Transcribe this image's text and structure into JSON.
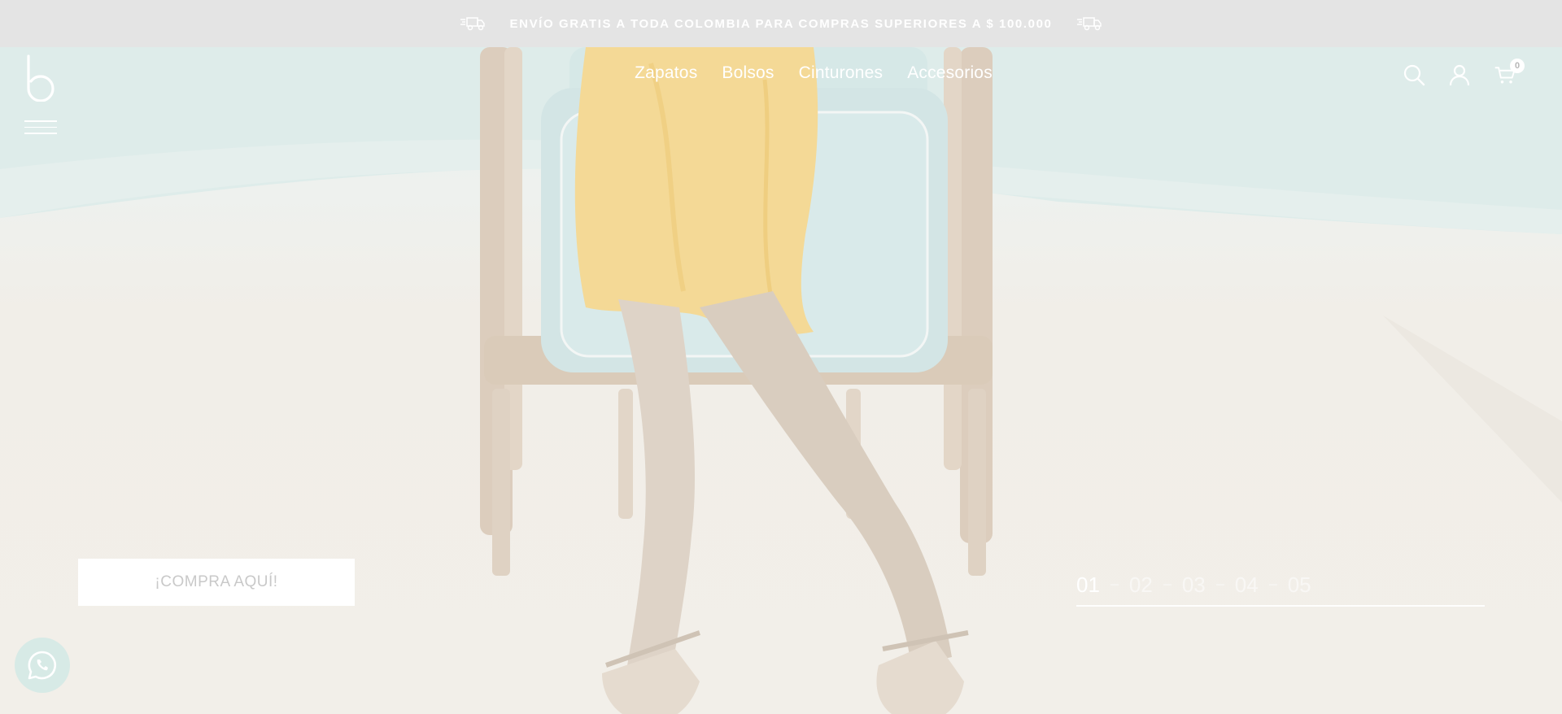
{
  "promo_bar": {
    "text": "ENVÍO GRATIS A TODA COLOMBIA PARA COMPRAS SUPERIORES A $ 100.000",
    "left_icon": "delivery-truck-icon",
    "right_icon": "delivery-truck-icon"
  },
  "header": {
    "logo_icon": "brand-b-logo-icon",
    "menu_icon": "hamburger-menu-icon",
    "nav": [
      {
        "label": "Zapatos"
      },
      {
        "label": "Bolsos"
      },
      {
        "label": "Cinturones"
      },
      {
        "label": "Accesorios"
      }
    ],
    "icons": {
      "search": "search-icon",
      "account": "user-icon",
      "cart": "shopping-cart-icon"
    },
    "cart_count": "0"
  },
  "hero": {
    "cta_label": "¡COMPRA AQUÍ!",
    "slides": [
      "01",
      "02",
      "03",
      "04",
      "05"
    ],
    "active_slide": "01"
  },
  "whatsapp": {
    "icon": "whatsapp-icon"
  },
  "colors": {
    "promo_bg": "#e4e4e4",
    "hero_bg": "#f1eee8",
    "pool": "#dcebea",
    "dress": "#f6dc9e",
    "chair_cushion": "#d6e7e6",
    "chair_frame": "#d8c8b6",
    "whatsapp_bg": "#d7eae6"
  }
}
